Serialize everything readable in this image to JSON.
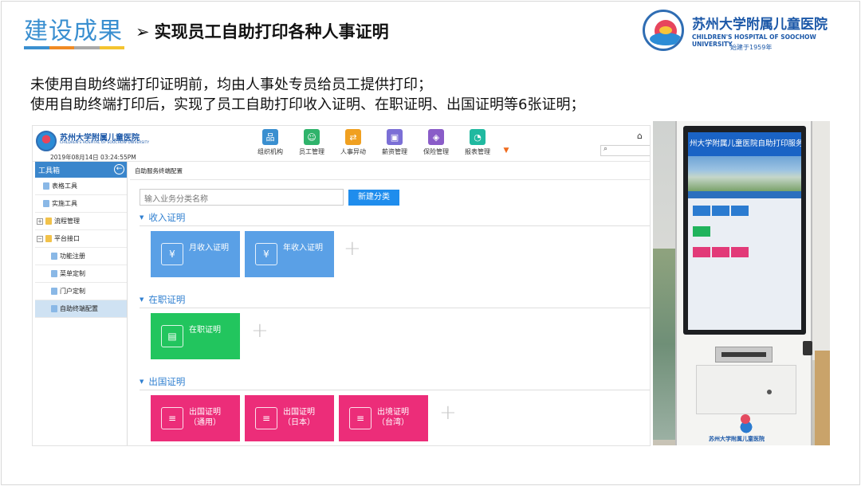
{
  "header": {
    "title": "建设成果",
    "arrow": "➢",
    "subtitle": "实现员工自助打印各种人事证明",
    "bar_colors": [
      "#3a8fd0",
      "#f08a24",
      "#a9a9a9",
      "#f4c430"
    ]
  },
  "logo": {
    "name_cn": "苏州大学附属儿童医院",
    "name_en": "CHILDREN'S HOSPITAL OF SOOCHOW UNIVERSITY",
    "founded": "始建于1959年"
  },
  "description": {
    "line1": "未使用自助终端打印证明前，均由人事处专员给员工提供打印；",
    "line2": "使用自助终端打印后，实现了员工自助打印收入证明、在职证明、出国证明等6张证明；"
  },
  "app": {
    "logo_cn": "苏州大学附属儿童医院",
    "logo_en": "CHILDREN'S HOSPITAL OF SOOCHOW UNIVERSITY",
    "datetime": "2019年08月14日 03:24:55PM",
    "nav": [
      {
        "label": "组织机构",
        "icon": "org-chart-icon",
        "color": "#3a8fd0"
      },
      {
        "label": "员工管理",
        "icon": "users-icon",
        "color": "#2fb36b"
      },
      {
        "label": "人事异动",
        "icon": "transfer-icon",
        "color": "#f0a020"
      },
      {
        "label": "薪资管理",
        "icon": "wallet-icon",
        "color": "#7b6fd6"
      },
      {
        "label": "保险管理",
        "icon": "shield-icon",
        "color": "#8a5cc8"
      },
      {
        "label": "报表管理",
        "icon": "pie-chart-icon",
        "color": "#20b9a0"
      }
    ],
    "more_icon": "▼",
    "home_icon": "⌂",
    "search_icon": "⌕",
    "sidebar": {
      "title": "工具箱",
      "collapse_icon": "←",
      "items": [
        {
          "label": "表格工具",
          "level": 1,
          "icon": "file-icon"
        },
        {
          "label": "实施工具",
          "level": 1,
          "icon": "file-icon"
        },
        {
          "label": "流程管理",
          "level": 0,
          "icon": "folder-icon",
          "toggle": "+"
        },
        {
          "label": "平台接口",
          "level": 0,
          "icon": "folder-icon",
          "toggle": "−"
        },
        {
          "label": "功能注册",
          "level": 2,
          "icon": "file-icon"
        },
        {
          "label": "菜单定制",
          "level": 2,
          "icon": "file-icon"
        },
        {
          "label": "门户定制",
          "level": 2,
          "icon": "file-icon"
        },
        {
          "label": "自助终端配置",
          "level": 2,
          "icon": "file-icon",
          "active": true
        }
      ]
    },
    "breadcrumb": "自助服务终端配置",
    "category_input_placeholder": "输入业务分类名称",
    "new_category_button": "新建分类",
    "add_symbol": "+",
    "sections": [
      {
        "title": "收入证明",
        "color": "#5aa0e6",
        "tiles": [
          {
            "label1": "月收入证明",
            "label2": "",
            "icon": "certificate-icon",
            "glyph": "¥"
          },
          {
            "label1": "年收入证明",
            "label2": "",
            "icon": "certificate-icon",
            "glyph": "¥"
          }
        ]
      },
      {
        "title": "在职证明",
        "color": "#22c55e",
        "tiles": [
          {
            "label1": "在职证明",
            "label2": "",
            "icon": "id-card-icon",
            "glyph": "▤"
          }
        ]
      },
      {
        "title": "出国证明",
        "color": "#ec2d79",
        "tiles": [
          {
            "label1": "出国证明",
            "label2": "（通用）",
            "icon": "document-icon",
            "glyph": "≡"
          },
          {
            "label1": "出国证明",
            "label2": "（日本）",
            "icon": "document-icon",
            "glyph": "≡"
          },
          {
            "label1": "出境证明",
            "label2": "（台湾）",
            "icon": "document-icon",
            "glyph": "≡"
          }
        ]
      }
    ]
  },
  "photo": {
    "screen_header": "州大学附属儿童医院自助打印服务系统！",
    "base_text": "苏州大学附属儿童医院"
  }
}
